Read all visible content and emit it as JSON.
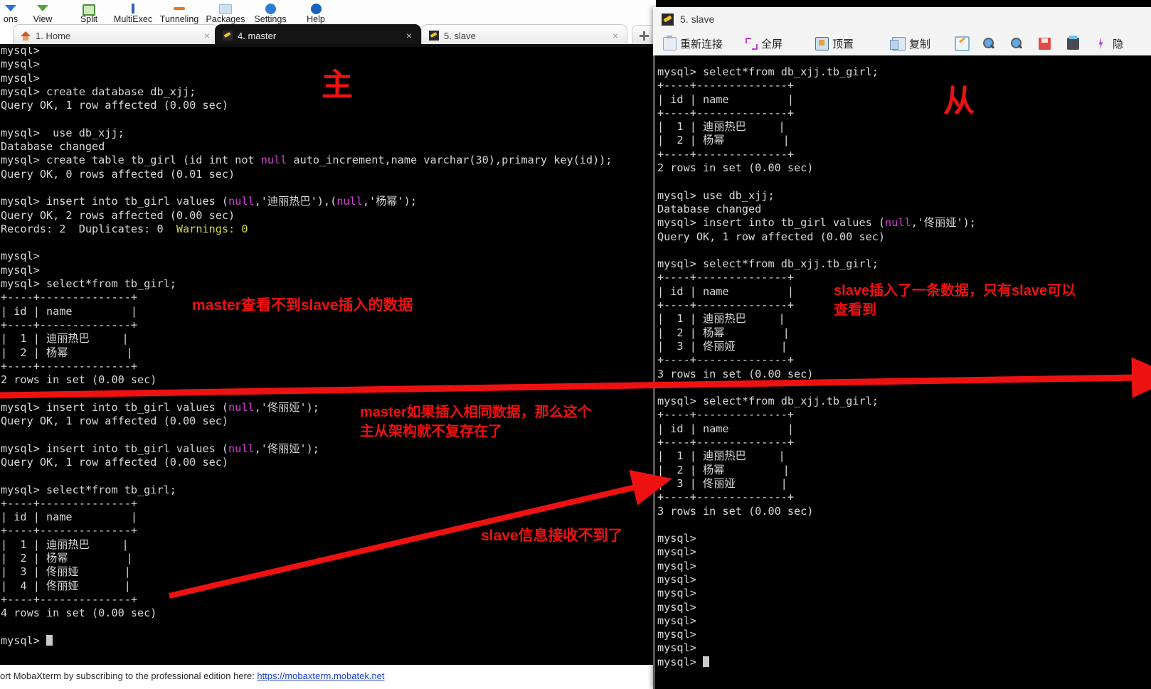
{
  "app": {
    "name": "MobaXterm",
    "toolbar_items": [
      {
        "label": "ons",
        "icon": "arrow-down-icon"
      },
      {
        "label": "View",
        "icon": "arrow-down-green-icon"
      },
      {
        "label": "Split",
        "icon": "split-icon"
      },
      {
        "label": "MultiExec",
        "icon": "multiexec-icon"
      },
      {
        "label": "Tunneling",
        "icon": "tunneling-icon"
      },
      {
        "label": "Packages",
        "icon": "packages-icon"
      },
      {
        "label": "Settings",
        "icon": "settings-icon"
      },
      {
        "label": "Help",
        "icon": "help-icon"
      }
    ],
    "tabs": [
      {
        "label": "1. Home",
        "icon": "home-icon",
        "active": false,
        "close": "×"
      },
      {
        "label": "4. master",
        "icon": "key-icon",
        "active": true,
        "close": "×"
      },
      {
        "label": "5. slave",
        "icon": "key-icon",
        "active": false,
        "close": "×"
      }
    ],
    "new_tab_label": "+",
    "statusbar": {
      "text": "ort MobaXterm by subscribing to the professional edition here:",
      "link": "https://mobaxterm.mobatek.net"
    }
  },
  "slave_window": {
    "title": "5. slave",
    "toolbar": [
      {
        "label": "重新连接",
        "icon": "reconnect-icon"
      },
      {
        "label": "全屏",
        "icon": "fullscreen-icon"
      },
      {
        "label": "顶置",
        "icon": "always-on-top-icon"
      },
      {
        "label": "复制",
        "icon": "copy-icon"
      },
      {
        "label": "",
        "icon": "edit-icon"
      },
      {
        "label": "",
        "icon": "zoom-in-icon"
      },
      {
        "label": "",
        "icon": "zoom-out-icon"
      },
      {
        "label": "",
        "icon": "save-icon"
      },
      {
        "label": "",
        "icon": "print-icon"
      },
      {
        "label": "",
        "icon": "bolt-icon"
      },
      {
        "label": "隐",
        "icon": "hide-icon"
      }
    ]
  },
  "master_terminal": {
    "lines": "mysql>\nmysql>\nmysql>\nmysql> create database db_xjj;\nQuery OK, 1 row affected (0.00 sec)\n\nmysql>  use db_xjj;\nDatabase changed\nmysql> create table tb_girl (id int not @null@ auto_increment,name varchar(30),primary key(id));\nQuery OK, 0 rows affected (0.01 sec)\n\nmysql> insert into tb_girl values (@null@,'迪丽热巴'),(@null@,'杨幂');\nQuery OK, 2 rows affected (0.00 sec)\nRecords: 2  Duplicates: 0  ~Warnings: 0~\n\nmysql>\nmysql>\nmysql> select*from tb_girl;\n+----+--------------+\n| id | name         |\n+----+--------------+\n|  1 | 迪丽热巴     |\n|  2 | 杨幂         |\n+----+--------------+\n2 rows in set (0.00 sec)\n\nmysql> insert into tb_girl values (@null@,'佟丽娅');\nQuery OK, 1 row affected (0.00 sec)\n\nmysql> insert into tb_girl values (@null@,'佟丽娅');\nQuery OK, 1 row affected (0.00 sec)\n\nmysql> select*from tb_girl;\n+----+--------------+\n| id | name         |\n+----+--------------+\n|  1 | 迪丽热巴     |\n|  2 | 杨幂         |\n|  3 | 佟丽娅       |\n|  4 | 佟丽娅       |\n+----+--------------+\n4 rows in set (0.00 sec)\n\nmysql> "
  },
  "slave_terminal": {
    "lines": "mysql> select*from db_xjj.tb_girl;\n+----+--------------+\n| id | name         |\n+----+--------------+\n|  1 | 迪丽热巴     |\n|  2 | 杨幂         |\n+----+--------------+\n2 rows in set (0.00 sec)\n\nmysql> use db_xjj;\nDatabase changed\nmysql> insert into tb_girl values (@null@,'佟丽娅');\nQuery OK, 1 row affected (0.00 sec)\n\nmysql> select*from db_xjj.tb_girl;\n+----+--------------+\n| id | name         |\n+----+--------------+\n|  1 | 迪丽热巴     |\n|  2 | 杨幂         |\n|  3 | 佟丽娅       |\n+----+--------------+\n3 rows in set (0.00 sec)\n\nmysql> select*from db_xjj.tb_girl;\n+----+--------------+\n| id | name         |\n+----+--------------+\n|  1 | 迪丽热巴     |\n|  2 | 杨幂         |\n|  3 | 佟丽娅       |\n+----+--------------+\n3 rows in set (0.00 sec)\n\nmysql>\nmysql>\nmysql>\nmysql>\nmysql>\nmysql>\nmysql>\nmysql>\nmysql>\nmysql> "
  },
  "annotations": {
    "accent_color": "#ee1111",
    "master_mark": "主",
    "slave_mark": "从",
    "note_master_cannot_see": "master查看不到slave插入的数据",
    "note_master_duplicate": "master如果插入相同数据，那么这个\n主从架构就不复存在了",
    "note_slave_only": "slave插入了一条数据，只有slave可以\n查看到",
    "note_slave_no_replication": "slave信息接收不到了"
  }
}
